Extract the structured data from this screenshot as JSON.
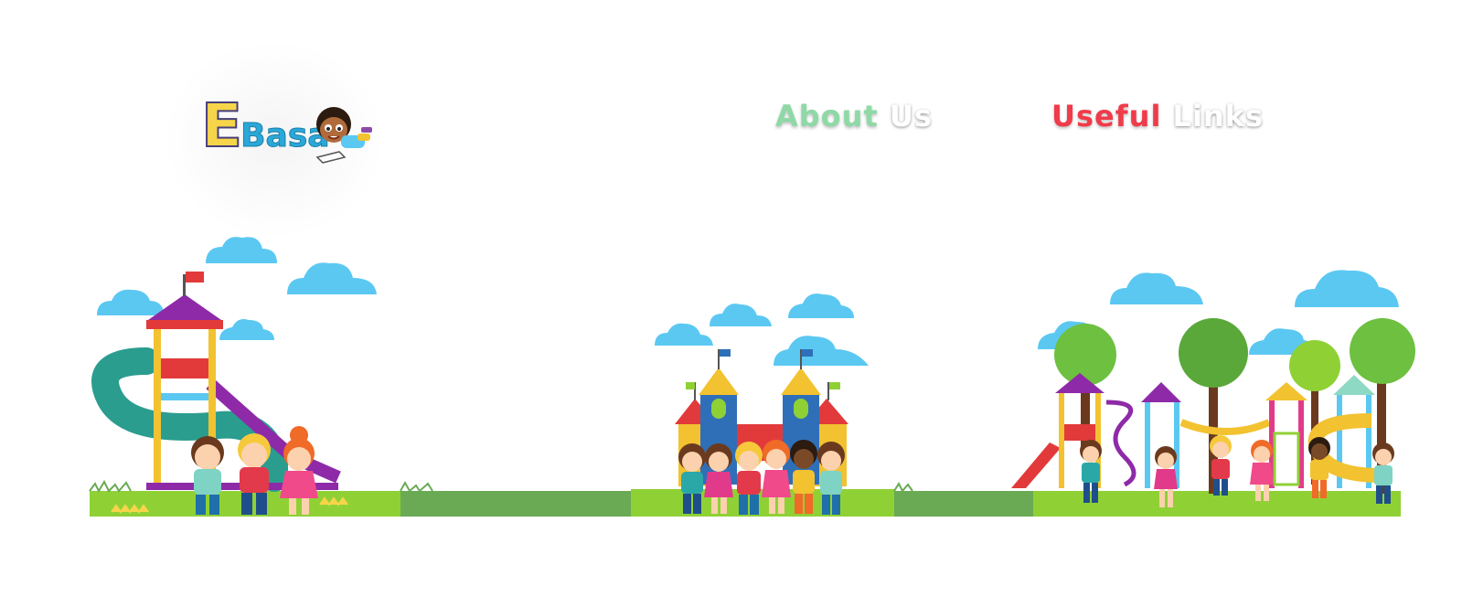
{
  "logo": {
    "letter": "E",
    "word": "Basa"
  },
  "nav": {
    "about": {
      "first": "About",
      "second": "Us",
      "color": "#8ed9a6"
    },
    "useful": {
      "first": "Useful",
      "second": "Links",
      "color": "#f03b4a"
    }
  },
  "colors": {
    "grass": "#8fd135",
    "grass_dark": "#6aaa55",
    "sky_cloud": "#5bc8f2",
    "accent_red": "#f03b4a",
    "accent_green": "#8ed9a6"
  },
  "illustration": {
    "left": "playground-slide-kids",
    "center": "castle-kids-group",
    "right": "playground-trees-kids"
  }
}
